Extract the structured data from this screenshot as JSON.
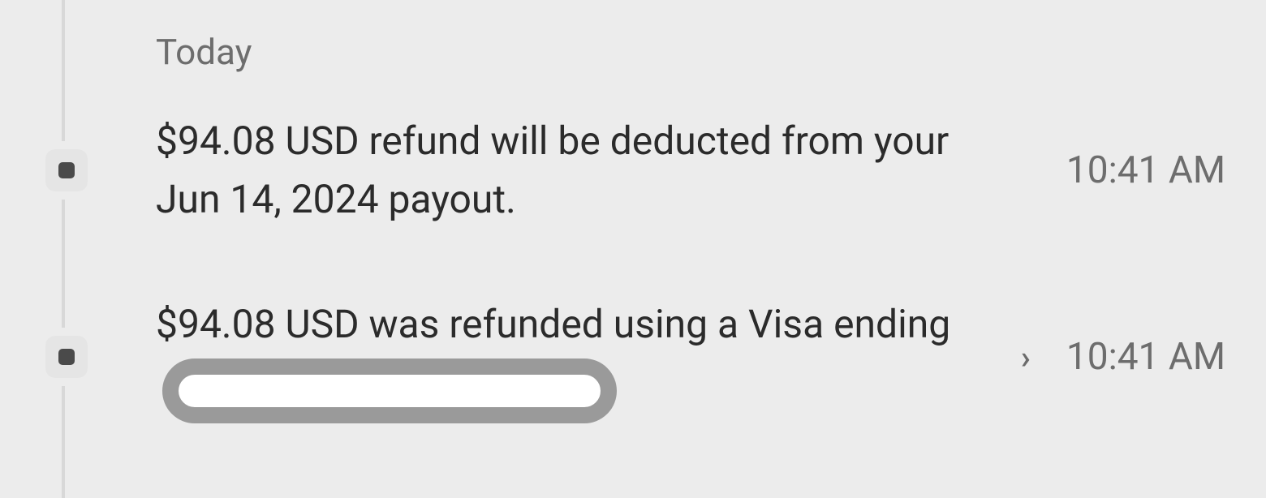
{
  "timeline": {
    "section": "Today",
    "entries": [
      {
        "text": "$94.08 USD refund will be deducted from your Jun 14, 2024 payout.",
        "time": "10:41 AM",
        "link": false
      },
      {
        "text_prefix": "$94.08 USD was refunded using a Visa ending",
        "time": "10:41 AM",
        "link": true,
        "redacted": true
      }
    ]
  }
}
